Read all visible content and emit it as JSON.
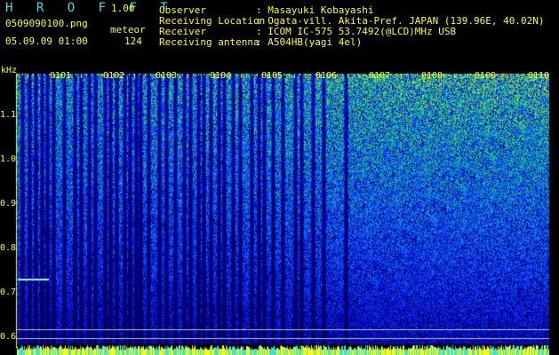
{
  "header": {
    "app_name": "H R O F F T",
    "version": "1.00",
    "filename": "0509090100.png",
    "datetime": "05.09.09 01:00",
    "meteor_label": "meteor",
    "meteor_count": "124"
  },
  "info": {
    "observer_label": "Observer",
    "observer_value": ": Masayuki Kobayashi",
    "location_label": "Receiving Location",
    "location_value": ": Ogata-vill. Akita-Pref. JAPAN (139.96E, 40.02N)",
    "receiver_label": "Receiver",
    "receiver_value": ": ICOM IC-575 53.7492(@LCD)MHz USB",
    "antenna_label": "Receiving antenna",
    "antenna_value": ": A504HB(yagi 4el)"
  },
  "axes": {
    "y_unit": "kHz",
    "y_ticks": [
      "1.1",
      "1.0",
      "0.9",
      "0.8",
      "0.7",
      "0.6"
    ],
    "x_ticks": [
      "0101",
      "0102",
      "0103",
      "0104",
      "0105",
      "0106",
      "0107",
      "0108",
      "0109",
      "0110"
    ]
  },
  "colors": {
    "text_yellow": "#ffff00",
    "text_cyan": "#40e0e0",
    "background": "#000000"
  }
}
